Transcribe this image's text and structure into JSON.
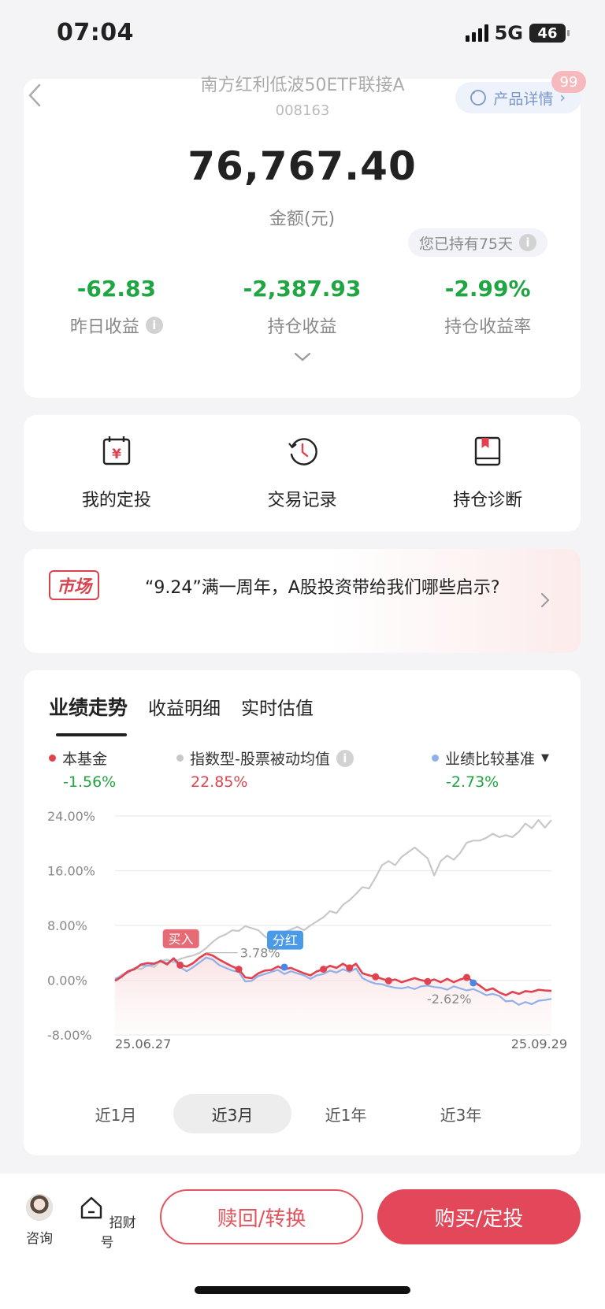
{
  "status_bar": {
    "time": "07:04",
    "network": "5G",
    "battery": "46"
  },
  "header": {
    "title": "南方红利低波50ETF联接A",
    "code": "008163",
    "detail_button": "产品详情",
    "notification_count": "99"
  },
  "summary": {
    "amount": "76,767.40",
    "amount_label": "金额(元)",
    "held_days": "您已持有75天",
    "stats": [
      {
        "value": "-62.83",
        "label": "昨日收益"
      },
      {
        "value": "-2,387.93",
        "label": "持仓收益"
      },
      {
        "value": "-2.99%",
        "label": "持仓收益率"
      }
    ]
  },
  "shortcuts": [
    {
      "label": "我的定投",
      "icon": "calendar-yen-icon"
    },
    {
      "label": "交易记录",
      "icon": "clock-history-icon"
    },
    {
      "label": "持仓诊断",
      "icon": "book-bookmark-icon"
    }
  ],
  "news": {
    "tag": "市场",
    "text": "“9.24”满一周年，A股投资带给我们哪些启示?"
  },
  "performance": {
    "tabs": [
      "业绩走势",
      "收益明细",
      "实时估值"
    ],
    "legend": [
      {
        "name": "本基金",
        "value": "-1.56%",
        "color": "#e0434f",
        "value_color": "#1fa541"
      },
      {
        "name": "指数型-股票被动均值",
        "value": "22.85%",
        "color": "#c8c8c8",
        "value_color": "#e0434f"
      },
      {
        "name": "业绩比较基准",
        "value": "-2.73%",
        "color": "#8fb0ea",
        "value_color": "#1fa541"
      }
    ],
    "ranges": [
      "近1月",
      "近3月",
      "近1年",
      "近3年"
    ],
    "active_range": "近3月"
  },
  "chart_data": {
    "type": "line",
    "ylim": [
      -8,
      24
    ],
    "y_ticks": [
      "24.00%",
      "16.00%",
      "8.00%",
      "0.00%",
      "-8.00%"
    ],
    "x_labels": [
      "25.06.27",
      "25.09.29"
    ],
    "annotations": {
      "buy": "买入",
      "dividend": "分红",
      "peak_label": "3.78%",
      "end_label": "-2.62%"
    },
    "series": [
      {
        "name": "指数型-股票被动均值",
        "color": "#c8c8c8",
        "values": [
          0,
          0.8,
          1.3,
          1.8,
          1.6,
          2.2,
          1.9,
          2.8,
          3.0,
          2.6,
          3.1,
          3.4,
          3.6,
          4.0,
          4.7,
          5.6,
          6.3,
          6.7,
          7.3,
          7.2,
          7.9,
          7.6,
          7.3,
          6.4,
          5.8,
          6.4,
          7.0,
          7.4,
          7.8,
          7.3,
          8.0,
          8.6,
          9.2,
          10.1,
          9.8,
          11.0,
          11.7,
          12.6,
          13.6,
          13.4,
          15.0,
          16.8,
          17.4,
          16.8,
          18.0,
          18.7,
          19.4,
          18.6,
          17.8,
          15.3,
          17.4,
          18.2,
          17.6,
          18.6,
          20.1,
          20.4,
          20.4,
          20.8,
          21.4,
          20.9,
          21.2,
          20.9,
          21.7,
          22.9,
          22.2,
          23.4,
          22.3,
          23.4
        ]
      },
      {
        "name": "业绩比较基准",
        "color": "#8fb0ea",
        "values": [
          0.2,
          0.6,
          1.1,
          1.7,
          2.2,
          2.1,
          2.3,
          2.9,
          2.5,
          3.0,
          1.9,
          1.3,
          1.9,
          2.6,
          3.3,
          3.0,
          2.2,
          1.8,
          1.4,
          1.2,
          -0.2,
          -0.1,
          0.6,
          0.9,
          1.2,
          1.5,
          0.9,
          1.3,
          1.0,
          0.7,
          0.2,
          0.7,
          0.9,
          1.4,
          1.1,
          1.6,
          1.2,
          1.7,
          0.3,
          -0.2,
          -0.5,
          -0.6,
          -0.9,
          -1.1,
          -1.2,
          -1.0,
          -1.3,
          -0.9,
          -0.8,
          -1.0,
          -1.1,
          -1.4,
          -0.9,
          -1.2,
          -1.5,
          -1.3,
          -1.7,
          -2.2,
          -2.0,
          -2.3,
          -3.1,
          -3.0,
          -3.6,
          -3.2,
          -3.5,
          -3.0,
          -2.9,
          -2.73
        ]
      },
      {
        "name": "本基金",
        "color": "#e0434f",
        "values": [
          -0.1,
          0.5,
          1.3,
          1.6,
          2.3,
          2.5,
          2.4,
          2.8,
          2.3,
          3.2,
          2.2,
          2.0,
          2.5,
          3.3,
          3.9,
          3.6,
          3.0,
          2.5,
          2.0,
          1.6,
          0.4,
          0.3,
          1.0,
          1.4,
          1.5,
          2.0,
          1.6,
          1.8,
          1.4,
          1.0,
          0.7,
          1.3,
          1.6,
          2.1,
          1.8,
          2.4,
          1.8,
          2.4,
          1.0,
          0.7,
          0.5,
          0.2,
          -0.1,
          0.1,
          -0.3,
          0.0,
          0.3,
          0.0,
          -0.2,
          0.1,
          -0.3,
          0.2,
          -0.3,
          0.1,
          0.4,
          -0.2,
          -0.8,
          -1.5,
          -1.2,
          -1.8,
          -2.2,
          -1.7,
          -2.0,
          -1.6,
          -1.7,
          -1.4,
          -1.5,
          -1.56
        ]
      }
    ]
  },
  "bottom_bar": {
    "consult": "咨询",
    "zhaocaihao": "招财号",
    "redeem": "赎回/转换",
    "buy": "购买/定投"
  }
}
